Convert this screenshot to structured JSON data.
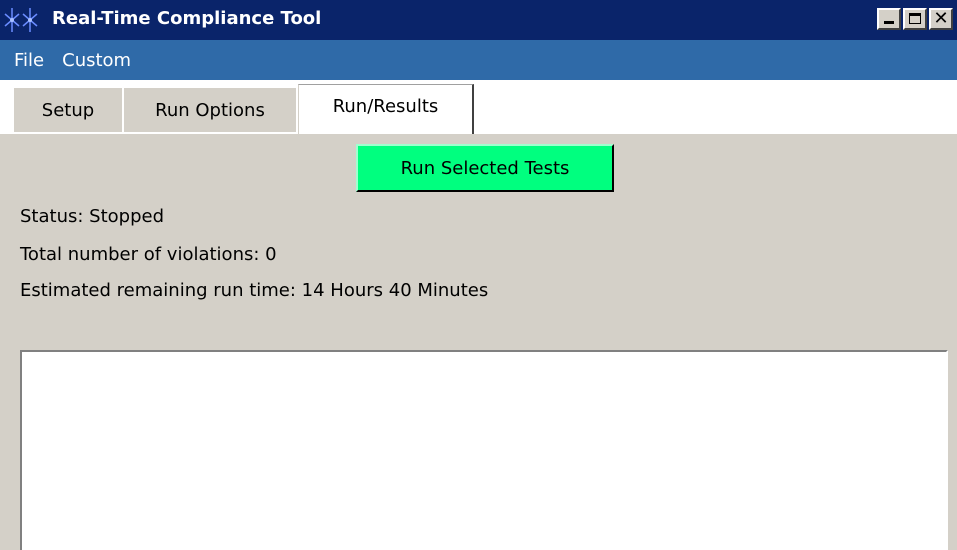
{
  "window": {
    "title": "Real-Time Compliance Tool",
    "icon": "snowflake-app-icon",
    "caption_buttons": [
      "minimize-icon",
      "maximize-icon",
      "close-icon"
    ],
    "close_glyph": "✕"
  },
  "menu": {
    "items": [
      {
        "label": "File"
      },
      {
        "label": "Custom"
      }
    ]
  },
  "tabs": [
    {
      "label": "Setup",
      "selected": false
    },
    {
      "label": "Run Options",
      "selected": false
    },
    {
      "label": "Run/Results",
      "selected": true
    }
  ],
  "run_results": {
    "run_button_label": "Run Selected Tests",
    "status": "Status: Stopped",
    "violations": "Total number of violations: 0",
    "remaining_time": "Estimated remaining run time: 14 Hours 40 Minutes",
    "output_text": ""
  },
  "colors": {
    "titlebar": "#0a246a",
    "menubar": "#2f6aa8",
    "run_button": "#00ff7f",
    "panel": "#d4d0c8"
  }
}
